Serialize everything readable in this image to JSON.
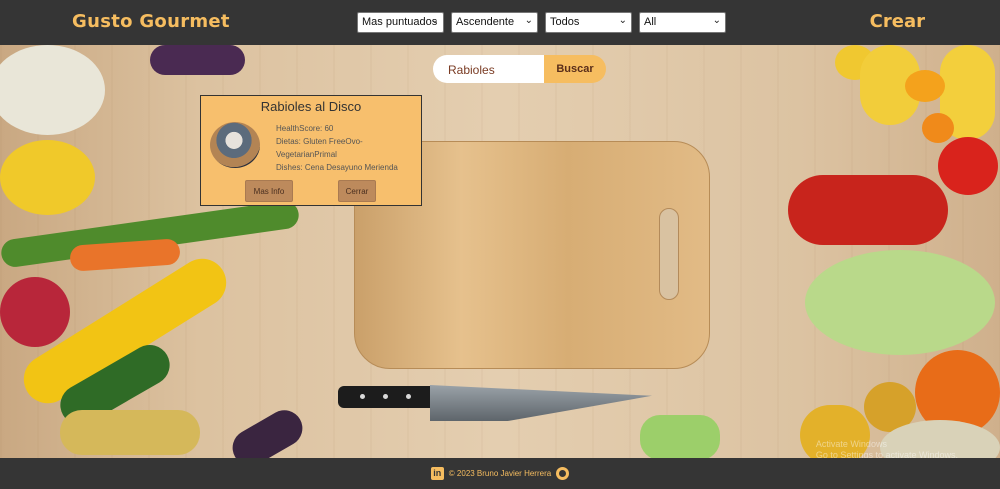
{
  "navbar": {
    "brand": "Gusto Gourmet",
    "create_label": "Crear",
    "filters": [
      {
        "name": "sort-by-select",
        "value": "Mas puntuados"
      },
      {
        "name": "order-select",
        "value": "Ascendente"
      },
      {
        "name": "diet-select",
        "value": "Todos"
      },
      {
        "name": "source-select",
        "value": "All"
      }
    ]
  },
  "search": {
    "value": "Rabioles",
    "button_label": "Buscar"
  },
  "card": {
    "title": "Rabioles al Disco",
    "health_score": "HealthScore: 60",
    "diets_line1": "Dietas: Gluten FreeOvo-",
    "diets_line2": "VegetarianPrimal",
    "dishes": "Dishes: Cena Desayuno Merienda",
    "more_info_label": "Mas Info",
    "close_label": "Cerrar"
  },
  "footer": {
    "copyright": "© 2023 Bruno Javier Herrera",
    "linkedin_icon": "linkedin-icon",
    "github_icon": "github-icon"
  },
  "watermark": {
    "line1": "Activate Windows",
    "line2": "Go to Settings to activate Windows."
  },
  "colors": {
    "accent": "#f6bd60",
    "bar": "#353535",
    "card": "#f7bf6d"
  }
}
